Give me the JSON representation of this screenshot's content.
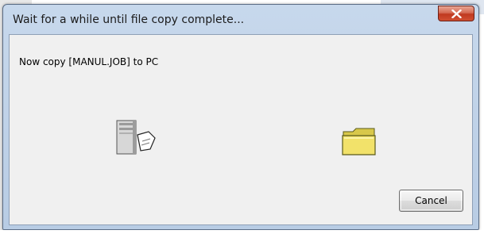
{
  "window": {
    "title": "Wait for a while until file copy complete...",
    "close_icon": "close-x-icon"
  },
  "dialog": {
    "message": "Now copy [MANUL.JOB] to PC",
    "source_icon": "pc-tower-with-document-icon",
    "destination_icon": "folder-icon",
    "cancel_label": "Cancel"
  },
  "colors": {
    "close_button": "#c7432a",
    "titlebar": "#c3d5ea",
    "client": "#f0f0f0",
    "folder": "#f2e26a"
  }
}
